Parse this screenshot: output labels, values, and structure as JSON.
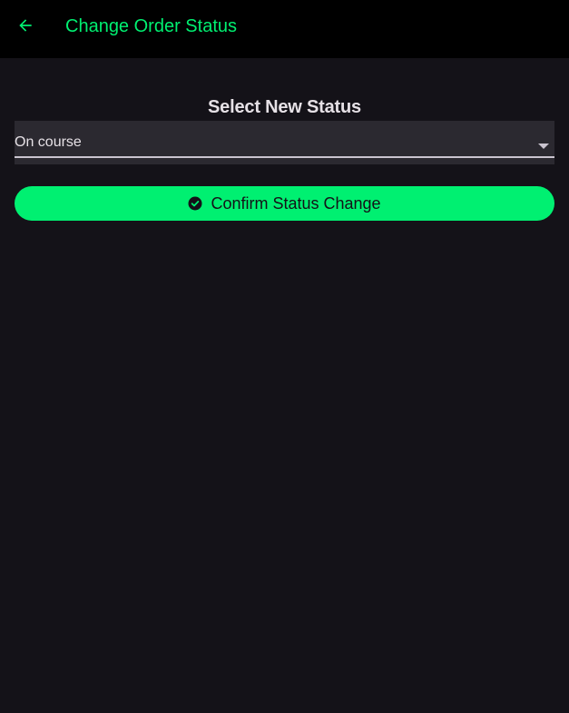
{
  "app_bar": {
    "title": "Change Order Status",
    "back_icon": "arrow-back-icon",
    "accent_color": "#00f071",
    "background": "#000000"
  },
  "form": {
    "heading": "Select New Status",
    "status_select": {
      "selected_value": "On course",
      "icon": "dropdown-arrow-icon"
    },
    "confirm_button": {
      "label": "Confirm Status Change",
      "icon": "check-circle-icon",
      "color": "#00f071"
    }
  },
  "page_background": "#141218"
}
